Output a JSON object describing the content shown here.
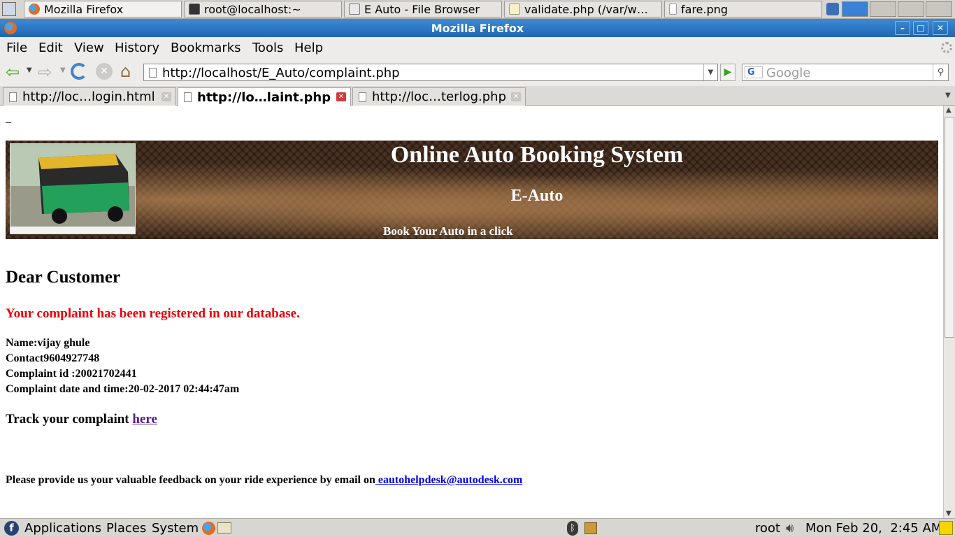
{
  "taskbar": {
    "tasks": [
      {
        "label": "Mozilla Firefox"
      },
      {
        "label": "root@localhost:~"
      },
      {
        "label": "E  Auto - File Browser"
      },
      {
        "label": "validate.php (/var/w…"
      },
      {
        "label": "fare.png"
      }
    ]
  },
  "window": {
    "title": "Mozilla Firefox",
    "controls": {
      "minimize": "–",
      "maximize": "□",
      "close": "✕"
    }
  },
  "menubar": {
    "items": [
      "File",
      "Edit",
      "View",
      "History",
      "Bookmarks",
      "Tools",
      "Help"
    ]
  },
  "navbar": {
    "url": "http://localhost/E_Auto/complaint.php",
    "search_placeholder": "Google"
  },
  "tabs": [
    {
      "label": "http://loc…login.html",
      "selected": false
    },
    {
      "label": "http://lo…laint.php",
      "selected": true
    },
    {
      "label": "http://loc…terlog.php",
      "selected": false
    }
  ],
  "page": {
    "top_mark": "_",
    "banner": {
      "title": "Online Auto Booking System",
      "subtitle": "E-Auto",
      "tagline": "Book Your Auto in a click"
    },
    "greeting": "Dear Customer",
    "notice": "Your complaint has been registered in our database.",
    "details": {
      "name": "Name:vijay ghule",
      "contact": "Contact9604927748",
      "complaint_id": "Complaint id :20021702441",
      "datetime": "Complaint date and time:20-02-2017 02:44:47am"
    },
    "track_text": "Track your complaint ",
    "track_link": "here",
    "feedback_text": "Please provide us your valuable feedback on your ride experience by email on",
    "feedback_email": " eautohelpdesk@autodesk.com",
    "colors": {
      "notice": "#e8000b",
      "link": "#551a8b",
      "email_link": "#0000ee"
    }
  },
  "bottom_panel": {
    "applications": "Applications",
    "places": "Places",
    "system": "System",
    "user": "root",
    "clock": "Mon Feb 20,  2:45 AM"
  }
}
